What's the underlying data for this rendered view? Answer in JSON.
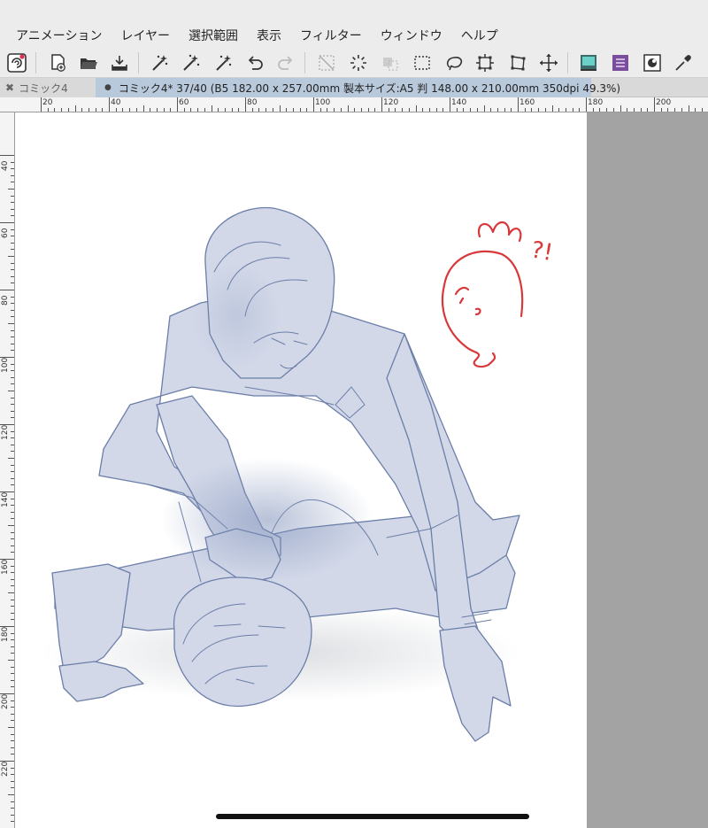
{
  "menu": {
    "items": [
      "アニメーション",
      "レイヤー",
      "選択範囲",
      "表示",
      "フィルター",
      "ウィンドウ",
      "ヘルプ"
    ]
  },
  "toolbar": {
    "icons": [
      "app-logo-icon",
      "new-file-icon",
      "open-folder-icon",
      "save-icon",
      "auto-action-1-icon",
      "auto-action-2-icon",
      "auto-action-3-icon",
      "undo-icon",
      "redo-icon",
      "clear-selection-icon",
      "rotate-icon",
      "transform-icon",
      "rect-select-icon",
      "lasso-icon",
      "crop-icon",
      "distort-icon",
      "move-icon",
      "color-panel-icon",
      "layer-panel-icon",
      "tone-icon",
      "eyedropper-icon"
    ]
  },
  "tabs": {
    "inactive_label": "コミック4",
    "active_label": "コミック4* 37/40 (B5 182.00 x 257.00mm 製本サイズ:A5 判 148.00 x 210.00mm 350dpi 49.3%)"
  },
  "ruler": {
    "h_labels": [
      "20",
      "40",
      "60",
      "80",
      "100",
      "120",
      "140",
      "160",
      "180",
      "200"
    ],
    "v_labels": [
      "40",
      "60",
      "80",
      "100",
      "120",
      "140",
      "160",
      "180",
      "200",
      "220"
    ]
  },
  "canvas": {
    "annotation_text": "?!",
    "sketch_color": "#8191b8",
    "annotation_color": "#d9383b",
    "page_color": "#ffffff",
    "workspace_color": "#a3a3a3"
  }
}
